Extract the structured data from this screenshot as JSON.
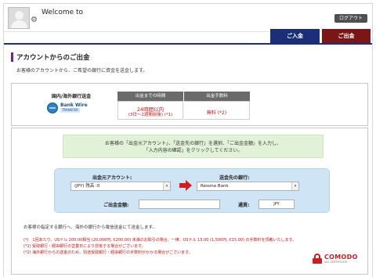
{
  "header": {
    "welcome": "Welcome to",
    "logout_label": "ログアウト"
  },
  "tabs": {
    "deposit_label": "ご入金",
    "withdraw_label": "ご出金"
  },
  "page": {
    "title": "アカウントからのご出金",
    "subtitle": "お客様のアカウントから、ご希望の銀行に資金を送金します。"
  },
  "method": {
    "region_label": "国内/海外銀行送金",
    "logo_text": "Bank Wire",
    "logo_sub": "TRANSFER",
    "col_time": "出金までの時間",
    "col_fee": "出金手数料",
    "time_main": "24時間以内",
    "time_sub": "(3日～2週間前後) (*1)",
    "fee": "無料 (*2)"
  },
  "form": {
    "instruction_line1": "お客様の「出金元アカウント」、「送金先の銀行」を選択、「ご出金金額」を入力し、",
    "instruction_line2": "「入力内容の確認」をクリックしてください。",
    "from_label": "出金元アカウント:",
    "from_value": "(JPY) 残高 :0",
    "to_label": "送金先の銀行:",
    "to_value": "Resona Bank",
    "amount_label": "ご出金金額:",
    "amount_value": "",
    "currency_label": "通貨:",
    "currency_value": "JPY"
  },
  "notes": {
    "main": "お客様の指定する銀行へ、海外の銀行から電信送金にて送金します。",
    "n1": "(*)　1回あたり、USドル 200.00相当 (20,000円, €200.00) 未満のお取引の場合、一律、USドル 15.00 (1,500円, €15.00) の手数料を頂戴いたします。",
    "n2": "(*1) 受取銀行・経由銀行の営業日により前後する場合がございます。",
    "n3": "(*2) 海外銀行からの送金のため、別途受取銀行・経由銀行の手数料がかかる場合がございます。"
  },
  "badge": {
    "name": "COMODO",
    "sub": "SSL CERTIFICATE"
  },
  "colors": {
    "deposit_tab": "#1a2f77",
    "withdraw_tab": "#7a1616",
    "accent_purple": "#6a2a8a",
    "warning_red": "#c01818",
    "panel_blue": "#cfe5f6",
    "instruction_green": "#e2f2d8"
  },
  "icons": {
    "avatar": "user-avatar-icon",
    "settings": "gear-icon",
    "arrow": "arrow-right-icon",
    "select": "chevron-down-icon",
    "lock": "lock-icon"
  }
}
